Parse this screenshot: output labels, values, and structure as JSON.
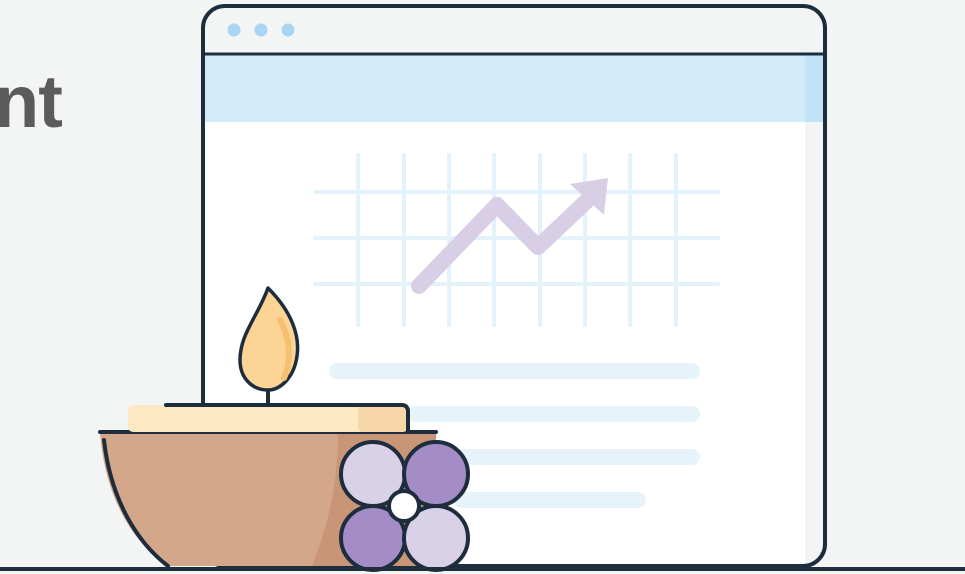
{
  "heading": {
    "visible_text": "nt"
  },
  "illustration": {
    "browser_window": {
      "dot_count": 3,
      "dot_color": "#a8d5f2",
      "title_bar_color": "#f3f4f4",
      "header_band_color": "#d2ebf9",
      "body_color": "#ffffff",
      "outline_color": "#1e2d3d"
    },
    "trend_chart": {
      "icon": "trending-up-arrow-icon",
      "arrow_color": "#d8cfe6",
      "grid_color": "#e4f2fb"
    },
    "text_lines": {
      "count": 4,
      "color": "#e6f3fb"
    },
    "candle": {
      "icon": "candle-flame-icon",
      "flame_color": "#fcd596",
      "wax_color": "#fde8c4",
      "bowl_color": "#d4a68a"
    },
    "flower": {
      "icon": "flower-icon",
      "petal_light": "#d9d1e8",
      "petal_dark": "#a48cc6",
      "center_color": "#ffffff"
    }
  }
}
